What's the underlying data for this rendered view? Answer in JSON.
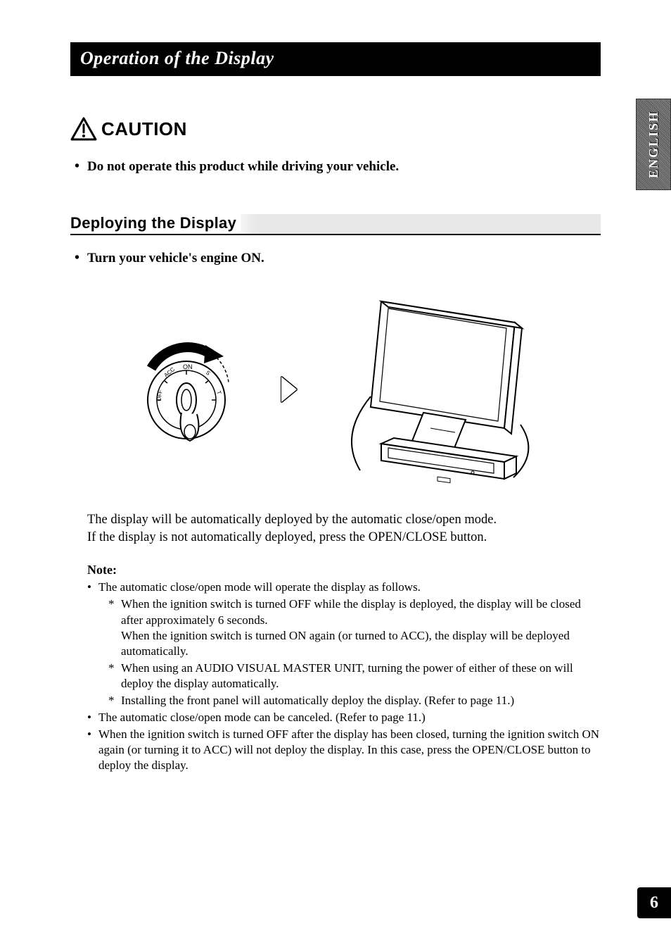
{
  "title_bar": "Operation of the Display",
  "caution_label": "CAUTION",
  "caution_bullet": "Do not operate this product while driving your vehicle.",
  "section_header": "Deploying the Display",
  "deploy_bullet": "Turn your vehicle's engine ON.",
  "ignition_labels": {
    "off": "OFF",
    "acc": "ACC",
    "on": "ON",
    "start_prefix": "S",
    "start_suffix": "T"
  },
  "body_line_1": "The display will be automatically deployed by the automatic close/open mode.",
  "body_line_2": "If the display is not automatically deployed, press the OPEN/CLOSE button.",
  "note_heading": "Note:",
  "note_items": {
    "b1": "The automatic close/open mode will operate the display as follows.",
    "b1_s1a": "When the ignition switch is turned OFF while the display is deployed, the display will be closed after approximately 6 seconds.",
    "b1_s1b": "When the ignition switch is turned ON again (or turned to ACC), the display will be deployed automatically.",
    "b1_s2": "When using an AUDIO VISUAL MASTER UNIT, turning the power of either of these on will deploy the display automatically.",
    "b1_s3": "Installing the front panel will automatically deploy the display. (Refer to page 11.)",
    "b2": "The automatic close/open mode can be canceled. (Refer to page 11.)",
    "b3": "When the ignition switch is turned OFF after the display has been closed, turning the ignition switch ON again (or turning it to ACC) will not deploy the display. In this case, press the OPEN/CLOSE button to deploy the display."
  },
  "lang_tab": "ENGLISH",
  "page_number": "6"
}
